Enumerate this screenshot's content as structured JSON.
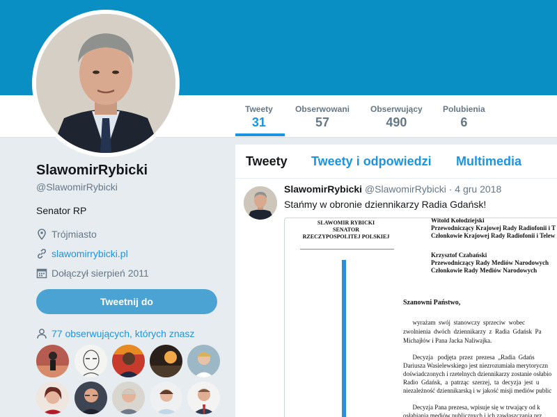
{
  "stats": [
    {
      "label": "Tweety",
      "value": "31"
    },
    {
      "label": "Obserwowani",
      "value": "57"
    },
    {
      "label": "Obserwujący",
      "value": "490"
    },
    {
      "label": "Polubienia",
      "value": "6"
    }
  ],
  "profile": {
    "name": "SlawomirRybicki",
    "handle": "@SlawomirRybicki",
    "bio": "Senator RP",
    "location": "Trójmiasto",
    "website": "slawomirrybicki.pl",
    "joined": "Dołączył sierpień 2011",
    "tweet_to_label": "Tweetnij do",
    "followers_you_know": "77 obserwujących, których znasz"
  },
  "timeline_tabs": [
    "Tweety",
    "Tweety i odpowiedzi",
    "Multimedia"
  ],
  "tweet": {
    "name": "SlawomirRybicki",
    "handle": "@SlawomirRybicki",
    "date": "· 4 gru 2018",
    "text": "Stańmy w obronie dziennikarzy Radia Gdańsk!",
    "doc": {
      "sender": [
        "SLAWOMIR RYBICKI",
        "SENATOR",
        "RZECZYPOSPOLITEJ POLSKIEJ"
      ],
      "recipients": [
        "Witold Kołodziejski",
        "Przewodniczący Krajowej Rady Radiofonii i T",
        "Członkowie Krajowej Rady Radiofonii i Telew",
        "",
        "Krzysztof Czabański",
        "Przewodniczący Rady Mediów Narodowych",
        "Członkowie Rady Mediów Narodowych"
      ],
      "greeting": "Szanowni Państwo,",
      "paragraphs": [
        "      wyrażam  swój  stanowczy  sprzeciw  wobec",
        "zwolnienia  dwóch  dziennikarzy  z  Radia  Gdańsk  Pa",
        "Michajłów i Pana Jacka Naliwajka.",
        "",
        "      Decyzja   podjęta  przez  prezesa  „Radia  Gdańs",
        "Dariusza Wasielewskiego jest niezrozumiała merytoryczn",
        "doświadczonych i rzetelnych dziennikarzy zostanie osłabio",
        "Radio  Gdańsk,  a  patrząc  szerzej,  ta  decyzja  jest  u",
        "niezależność dziennikarską i w jakość misji mediów public",
        "",
        "      Decyzja Pana prezesa, wpisuje się w trwający od k",
        "osłabiania mediów publicznych i ich zawłaszczania prz"
      ]
    }
  },
  "colors": {
    "banner": "#0a8fc4",
    "accent": "#1b95e0",
    "tweet_button": "#4ba3d3",
    "page_bg": "#e6ecf0"
  },
  "icons": [
    "location-icon",
    "link-icon",
    "calendar-icon",
    "person-icon"
  ]
}
